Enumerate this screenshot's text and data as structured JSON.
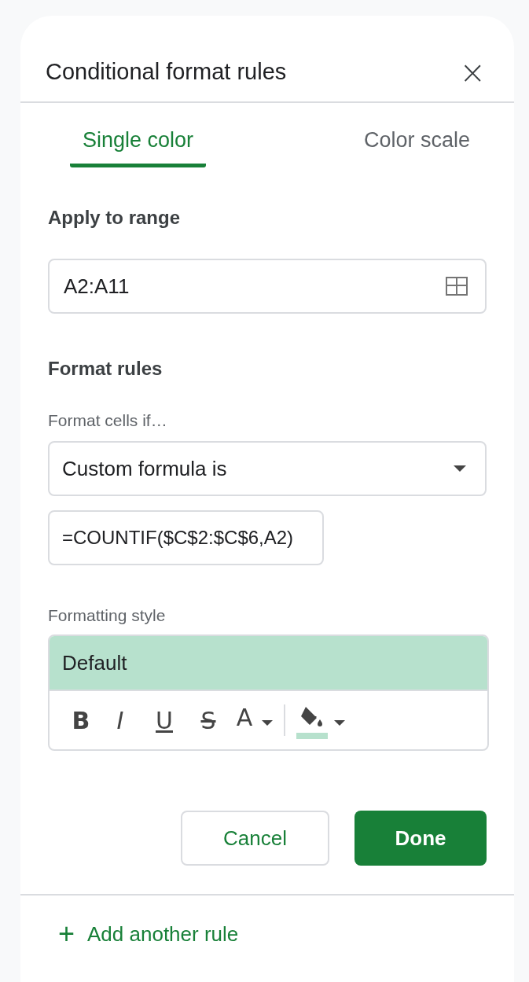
{
  "panel": {
    "title": "Conditional format rules",
    "close": "×"
  },
  "tabs": [
    {
      "label": "Single color",
      "selected": true
    },
    {
      "label": "Color scale",
      "selected": false
    }
  ],
  "range": {
    "heading": "Apply to range",
    "value": "A2:A11"
  },
  "rules": {
    "heading": "Format rules",
    "condition_label": "Format cells if…",
    "condition": "Custom formula is",
    "formula": "=COUNTIF($C$2:$C$6,A2)"
  },
  "style": {
    "heading": "Formatting style",
    "preview": "Default",
    "color": "#b7e1cd",
    "toolbar": [
      {
        "kind": "bold",
        "label": "B"
      },
      {
        "kind": "italic",
        "label": "I"
      },
      {
        "kind": "underline",
        "label": "U"
      },
      {
        "kind": "strike",
        "label": "S"
      },
      {
        "kind": "text_color",
        "label": "A"
      },
      {
        "kind": "fill_color",
        "color": "#b7e1cd"
      }
    ]
  },
  "buttons": {
    "cancel": "Cancel",
    "done": "Done"
  },
  "add_rule": {
    "icon": "+",
    "label": "Add another rule"
  }
}
